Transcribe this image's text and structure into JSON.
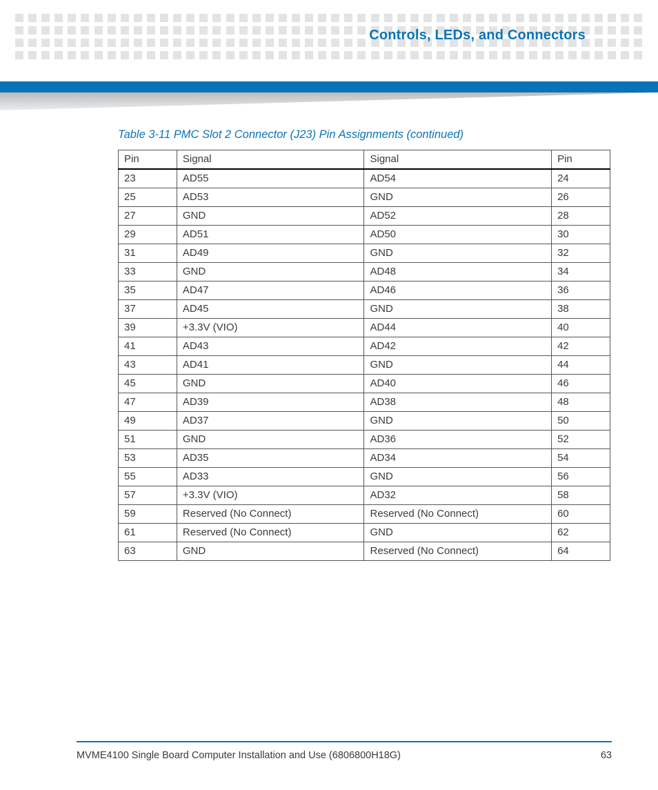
{
  "header": {
    "chapter_title": "Controls, LEDs, and Connectors"
  },
  "table": {
    "caption": "Table 3-11 PMC Slot 2 Connector (J23) Pin Assignments (continued)",
    "headers": {
      "pin_l": "Pin",
      "sig_l": "Signal",
      "sig_r": "Signal",
      "pin_r": "Pin"
    },
    "rows": [
      {
        "pin_l": "23",
        "sig_l": "AD55",
        "sig_r": "AD54",
        "pin_r": "24"
      },
      {
        "pin_l": "25",
        "sig_l": "AD53",
        "sig_r": "GND",
        "pin_r": "26"
      },
      {
        "pin_l": "27",
        "sig_l": "GND",
        "sig_r": "AD52",
        "pin_r": "28"
      },
      {
        "pin_l": "29",
        "sig_l": "AD51",
        "sig_r": "AD50",
        "pin_r": "30"
      },
      {
        "pin_l": "31",
        "sig_l": "AD49",
        "sig_r": "GND",
        "pin_r": "32"
      },
      {
        "pin_l": "33",
        "sig_l": "GND",
        "sig_r": "AD48",
        "pin_r": "34"
      },
      {
        "pin_l": "35",
        "sig_l": "AD47",
        "sig_r": "AD46",
        "pin_r": "36"
      },
      {
        "pin_l": "37",
        "sig_l": "AD45",
        "sig_r": "GND",
        "pin_r": "38"
      },
      {
        "pin_l": "39",
        "sig_l": "+3.3V (VIO)",
        "sig_r": "AD44",
        "pin_r": "40"
      },
      {
        "pin_l": "41",
        "sig_l": "AD43",
        "sig_r": "AD42",
        "pin_r": "42"
      },
      {
        "pin_l": "43",
        "sig_l": "AD41",
        "sig_r": "GND",
        "pin_r": "44"
      },
      {
        "pin_l": "45",
        "sig_l": "GND",
        "sig_r": "AD40",
        "pin_r": "46"
      },
      {
        "pin_l": "47",
        "sig_l": "AD39",
        "sig_r": "AD38",
        "pin_r": "48"
      },
      {
        "pin_l": "49",
        "sig_l": "AD37",
        "sig_r": "GND",
        "pin_r": "50"
      },
      {
        "pin_l": "51",
        "sig_l": "GND",
        "sig_r": "AD36",
        "pin_r": "52"
      },
      {
        "pin_l": "53",
        "sig_l": "AD35",
        "sig_r": "AD34",
        "pin_r": "54"
      },
      {
        "pin_l": "55",
        "sig_l": "AD33",
        "sig_r": "GND",
        "pin_r": "56"
      },
      {
        "pin_l": "57",
        "sig_l": "+3.3V (VIO)",
        "sig_r": "AD32",
        "pin_r": "58"
      },
      {
        "pin_l": "59",
        "sig_l": "Reserved (No Connect)",
        "sig_r": "Reserved (No Connect)",
        "pin_r": "60"
      },
      {
        "pin_l": "61",
        "sig_l": "Reserved (No Connect)",
        "sig_r": "GND",
        "pin_r": "62"
      },
      {
        "pin_l": "63",
        "sig_l": "GND",
        "sig_r": "Reserved (No Connect)",
        "pin_r": "64"
      }
    ]
  },
  "footer": {
    "doc_title": "MVME4100 Single Board Computer Installation and Use (6806800H18G)",
    "page_number": "63"
  }
}
